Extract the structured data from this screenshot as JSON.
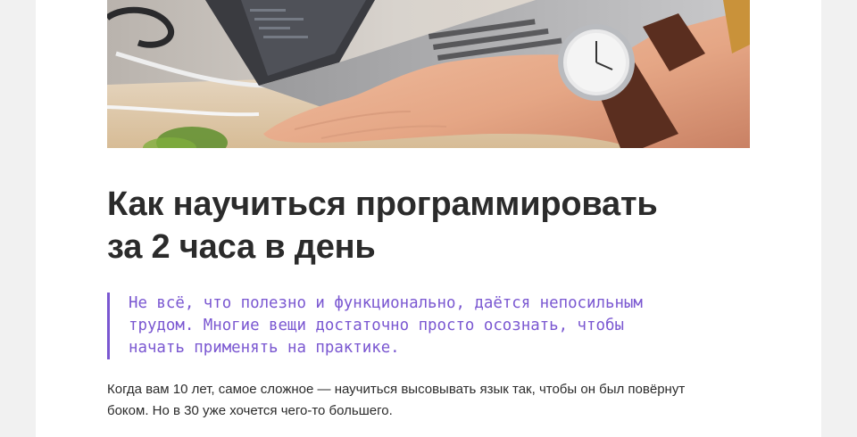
{
  "article": {
    "title": "Как научиться программировать\nза 2 часа в день",
    "quote": "Не всё, что полезно и функционально, даётся непосильным\nтрудом. Многие вещи достаточно просто осознать, чтобы\nначать применять на практике.",
    "paragraph": "Когда вам 10 лет, самое сложное — научиться высовывать язык так, чтобы он был повёрнут\nбоком. Но в 30 уже хочется чего-то большего."
  },
  "colors": {
    "accent": "#7a57d1",
    "text": "#2b2b2b",
    "page_background": "#f1f1f1",
    "card_background": "#ffffff"
  }
}
